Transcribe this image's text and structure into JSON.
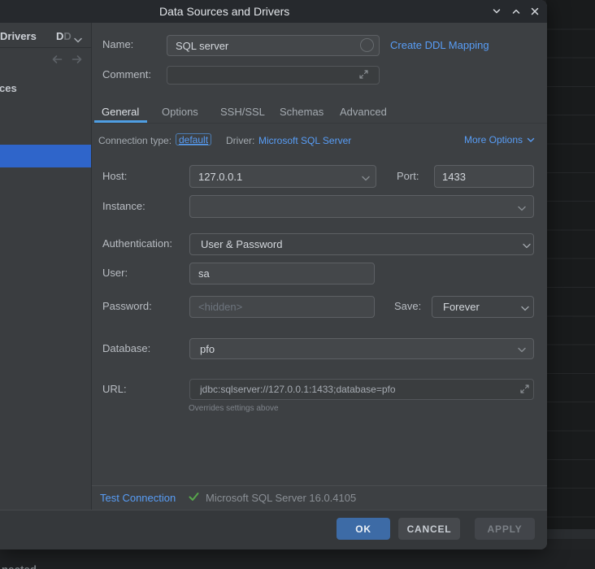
{
  "window": {
    "title": "Data Sources and Drivers",
    "status_bar_text": "nected"
  },
  "icons": {
    "window_controls": [
      "chevron-down-icon",
      "chevron-up-icon",
      "close-icon"
    ],
    "name_field": "loading-spinner-icon",
    "comment_field": "expand-icon",
    "url_field": "expand-icon",
    "combos": "chevron-down-icon",
    "sidebar_nav": [
      "arrow-left-icon",
      "arrow-right-icon"
    ],
    "test_status": "checkmark-icon"
  },
  "colors": {
    "selection_blue": "#2f65ca",
    "link_blue": "#589df6",
    "tab_underline": "#4f9ee3",
    "ok_button": "#3d6ba6",
    "success_green": "#57a64b"
  },
  "sidebar": {
    "tab_drivers": "Drivers",
    "tab_truncated_visible": "D",
    "tab_truncated_fade": "D",
    "list_item_tail": "ces"
  },
  "header": {
    "name_label": "Name:",
    "name_value": "SQL server",
    "ddl_link": "Create DDL Mapping",
    "comment_label": "Comment:",
    "comment_value": ""
  },
  "tabs": {
    "general": "General",
    "options": "Options",
    "ssh_ssl": "SSH/SSL",
    "schemas": "Schemas",
    "advanced": "Advanced",
    "active": "General"
  },
  "connection": {
    "type_label": "Connection type:",
    "type_value": "default",
    "driver_label": "Driver:",
    "driver_value": "Microsoft SQL Server",
    "more_options": "More Options"
  },
  "form": {
    "host_label": "Host:",
    "host_value": "127.0.0.1",
    "port_label": "Port:",
    "port_value": "1433",
    "instance_label": "Instance:",
    "instance_value": "",
    "auth_label": "Authentication:",
    "auth_value": "User & Password",
    "user_label": "User:",
    "user_value": "sa",
    "password_label": "Password:",
    "password_placeholder": "<hidden>",
    "save_label": "Save:",
    "save_value": "Forever",
    "database_label": "Database:",
    "database_value": "pfo",
    "url_label": "URL:",
    "url_value": "jdbc:sqlserver://127.0.0.1:1433;database=pfo",
    "url_note": "Overrides settings above"
  },
  "test": {
    "link": "Test Connection",
    "result": "Microsoft SQL Server 16.0.4105"
  },
  "footer": {
    "ok": "OK",
    "cancel": "CANCEL",
    "apply": "APPLY"
  }
}
